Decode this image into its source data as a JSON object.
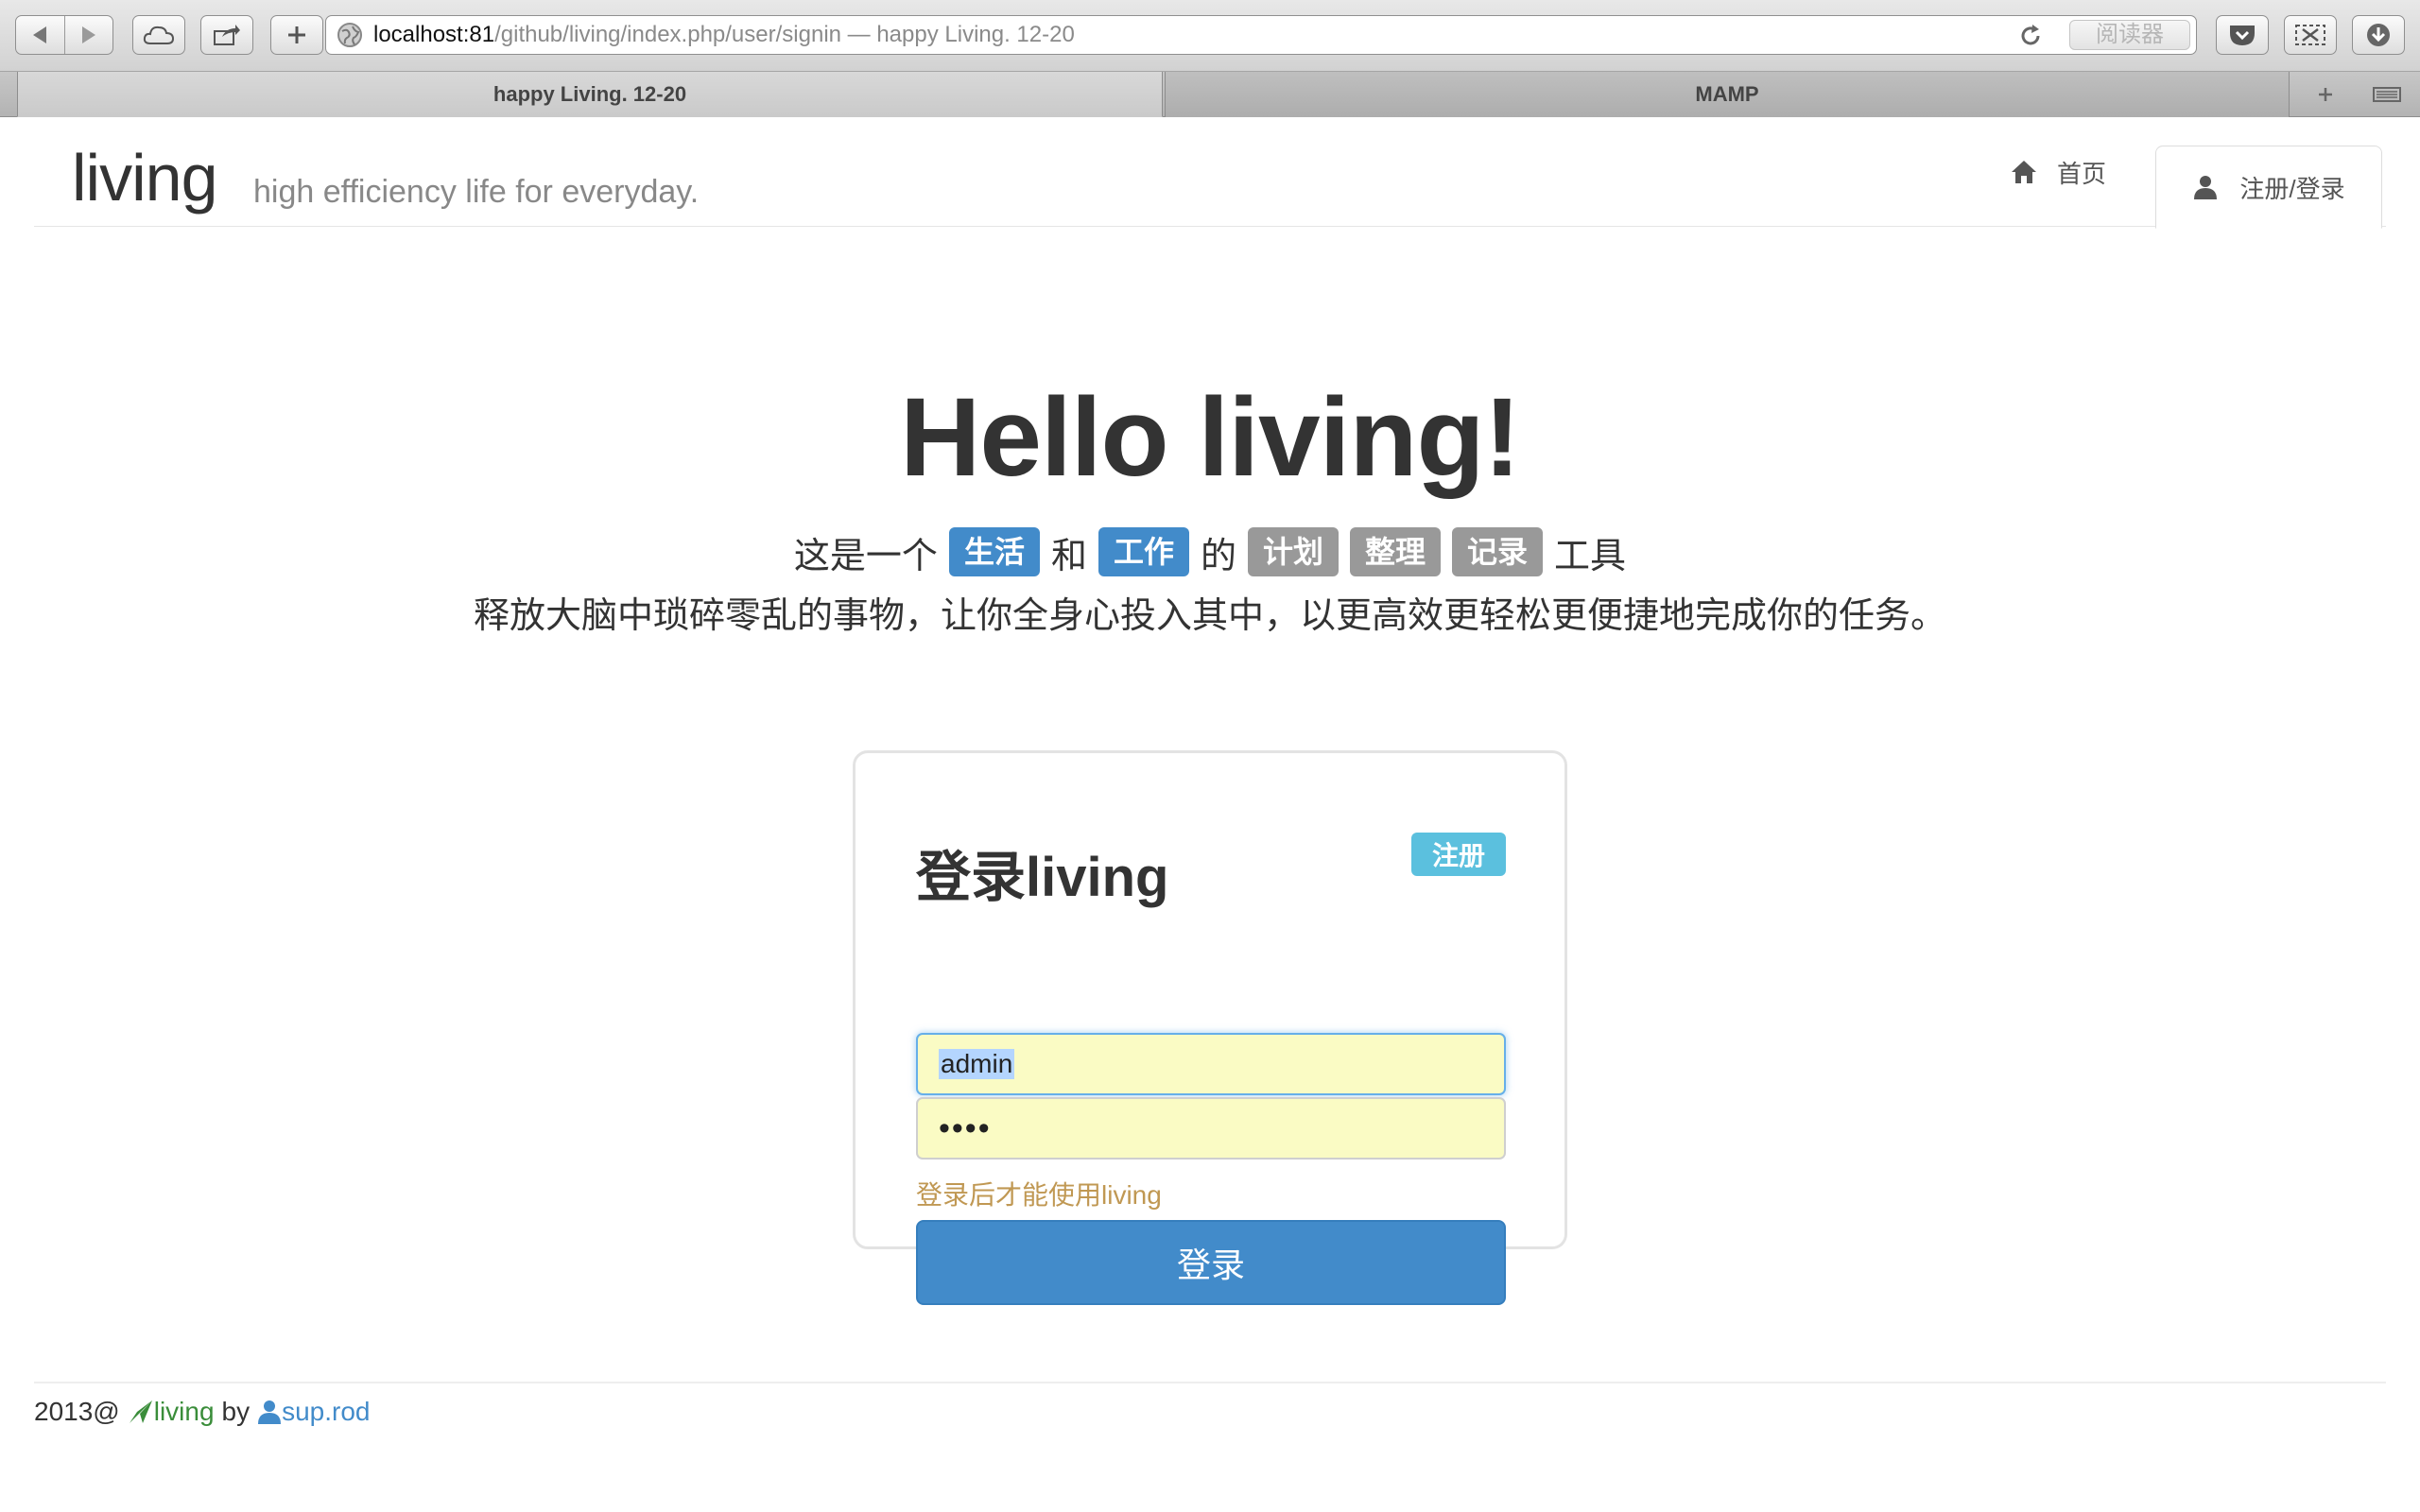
{
  "browser": {
    "address": {
      "host": "localhost:81",
      "path": "/github/living/index.php/user/signin — happy Living. 12-20"
    },
    "reader_label": "阅读器",
    "tabs": [
      {
        "label": "happy Living. 12-20",
        "active": true
      },
      {
        "label": "MAMP",
        "active": false
      }
    ]
  },
  "navbar": {
    "brand": "living",
    "slogan": "high efficiency life for everyday.",
    "home_label": "首页",
    "signin_label": "注册/登录"
  },
  "hero": {
    "title": "Hello living!",
    "line1_prefix": "这是一个",
    "tag_life": "生活",
    "and": "和",
    "tag_work": "工作",
    "of": "的",
    "tag_plan": "计划",
    "tag_organize": "整理",
    "tag_record": "记录",
    "line1_suffix": "工具",
    "line2": "释放大脑中琐碎零乱的事物，让你全身心投入其中，以更高效更轻松更便捷地完成你的任务。"
  },
  "login": {
    "title": "登录living",
    "register_label": "注册",
    "username_value": "admin",
    "password_masked": "••••",
    "hint": "登录后才能使用living",
    "submit_label": "登录"
  },
  "footer": {
    "year": "2013@",
    "app": "living",
    "by": "by",
    "author": "sup.rod"
  },
  "colors": {
    "primary": "#428bca",
    "info": "#5bc0de",
    "muted_badge": "#999999",
    "warning_text": "#c09853",
    "autofill": "#fafbc4",
    "footer_green": "#3a8d3a"
  }
}
